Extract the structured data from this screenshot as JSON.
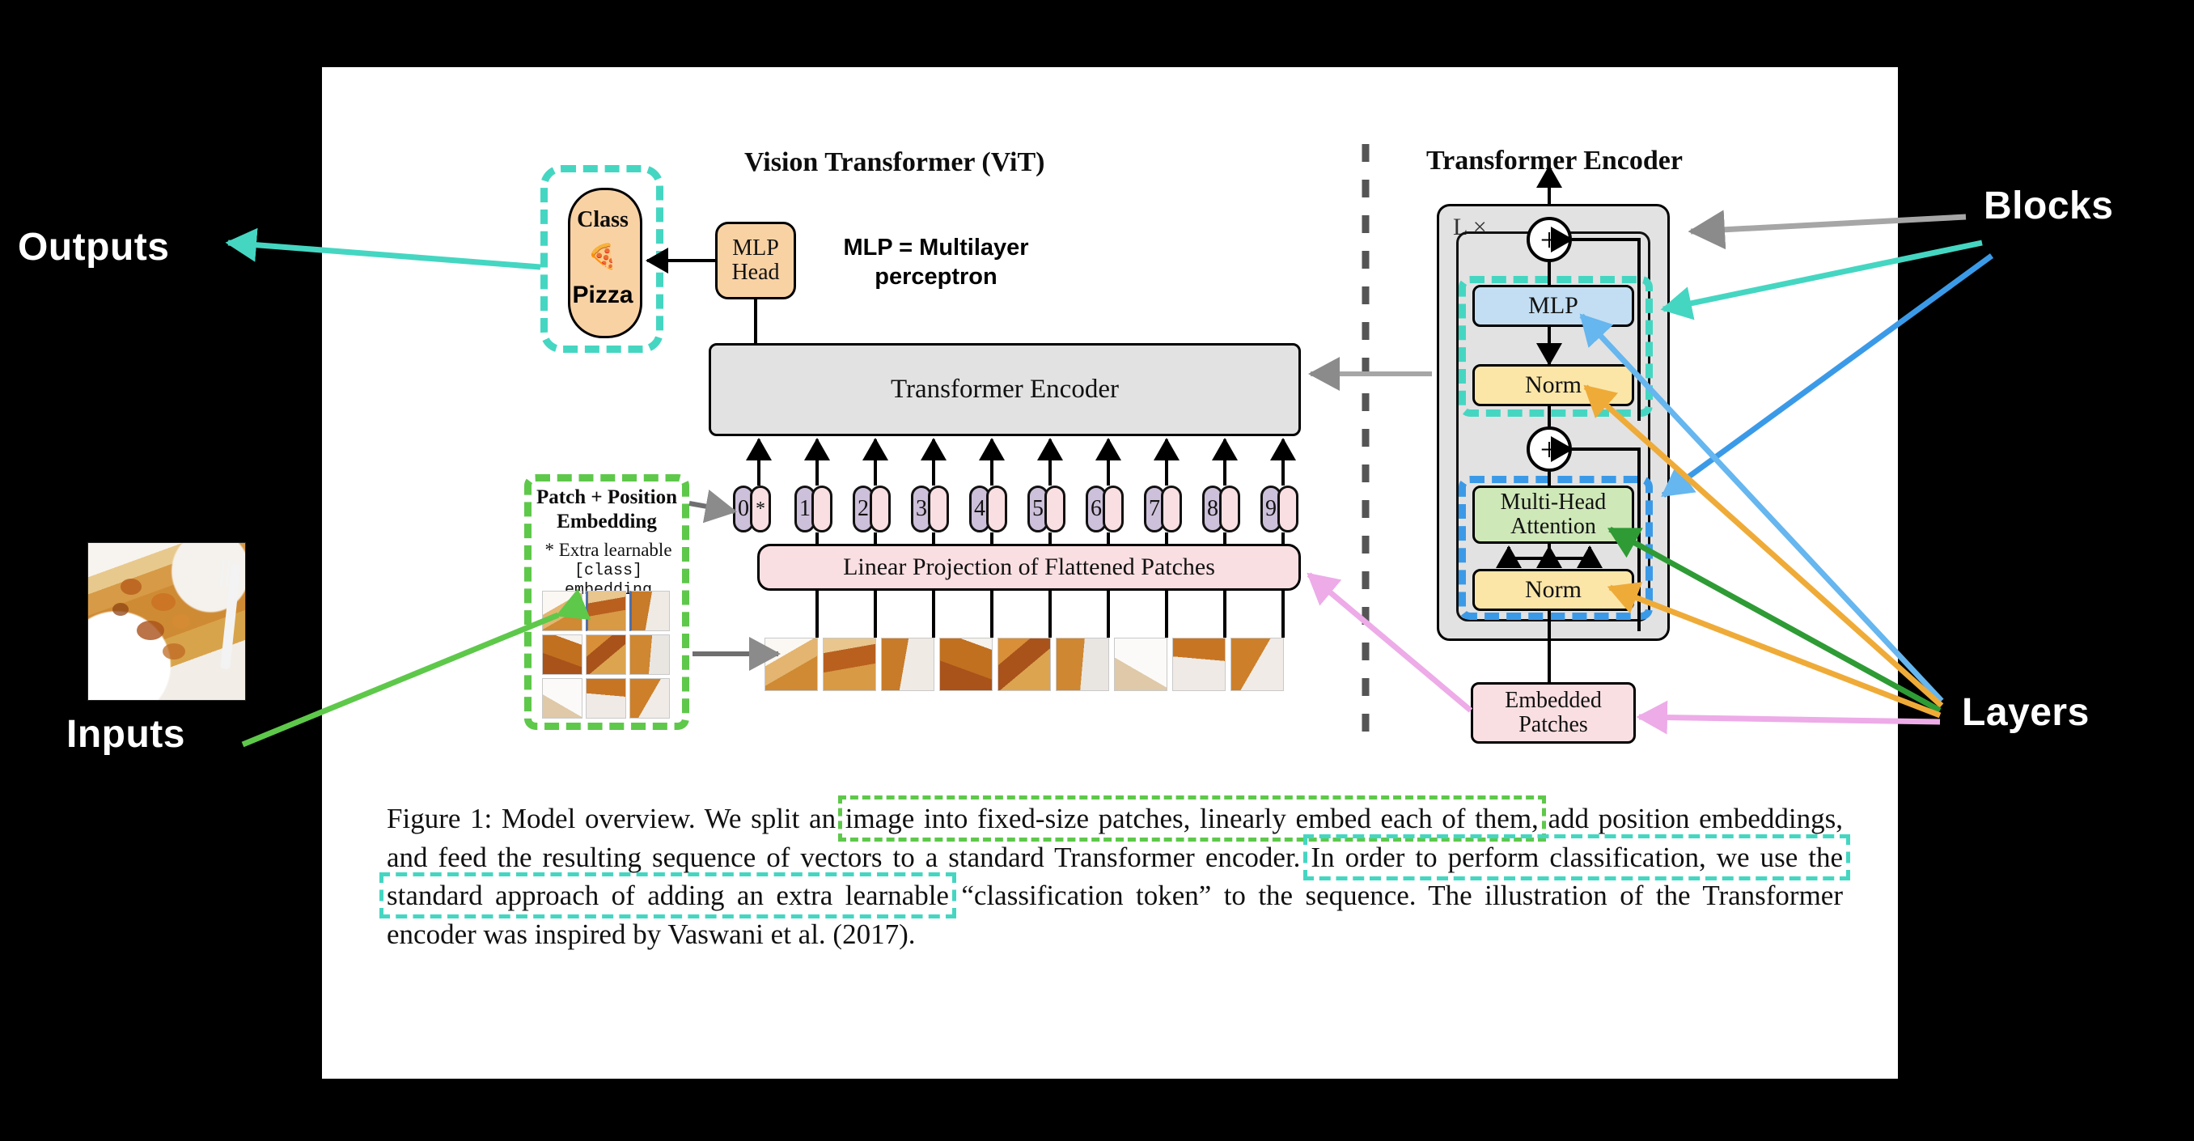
{
  "annotations": {
    "outputs": "Outputs",
    "inputs": "Inputs",
    "blocks": "Blocks",
    "layers": "Layers"
  },
  "figure": {
    "left_title": "Vision Transformer (ViT)",
    "right_title": "Transformer Encoder",
    "mlp_legend_line1": "MLP = Multilayer",
    "mlp_legend_line2": "perceptron",
    "class_label": "Class",
    "class_value": "Pizza",
    "class_emoji": "🍕",
    "mlp_head_line1": "MLP",
    "mlp_head_line2": "Head",
    "transformer_encoder_box": "Transformer Encoder",
    "patch_pos_title_line1": "Patch + Position",
    "patch_pos_title_line2": "Embedding",
    "patch_pos_note_line1": "* Extra learnable",
    "patch_pos_note_line2": "[class] embedding",
    "linear_projection": "Linear Projection of Flattened Patches",
    "tokens": [
      "0",
      "1",
      "2",
      "3",
      "4",
      "5",
      "6",
      "7",
      "8",
      "9"
    ],
    "class_token_star": "*",
    "repeat_label": "L ×",
    "plus_symbol": "+",
    "encoder_blocks": {
      "mlp": "MLP",
      "norm_top": "Norm",
      "multi_head_attention_line1": "Multi-Head",
      "multi_head_attention_line2": "Attention",
      "norm_bottom": "Norm",
      "embedded_patches_line1": "Embedded",
      "embedded_patches_line2": "Patches"
    }
  },
  "caption": {
    "seg1": "Figure 1: Model overview. We split an ",
    "seg2_highlight_green": "image into fixed-size patches, linearly embed each of them,",
    "seg3": " add position embeddings, and feed the resulting sequence of vectors to a standard Transformer encoder. ",
    "seg4_highlight_teal": "In order to perform classification, we use the standard approach of adding an extra learnable",
    "seg5": " “classification token” to the sequence. The illustration of the Transformer encoder was inspired by Vaswani et al. (2017)."
  },
  "colors": {
    "teal": "#45d6c2",
    "green": "#5ec84a",
    "blue": "#3b9ae8",
    "gray_arrow": "#a6a6a6",
    "orange_arrow": "#efab38",
    "dark_green_arrow": "#2e9b35",
    "pink_arrow": "#edabe8",
    "light_blue_arrow": "#66b6ef",
    "box_orange": "#f9d2a4",
    "box_gray": "#e2e2e2",
    "box_pink": "#fadfe2",
    "box_blue": "#c3def2",
    "box_yellow": "#fbe6a8",
    "box_green": "#cfe8b8",
    "background": "#000000",
    "panel": "#ffffff"
  }
}
